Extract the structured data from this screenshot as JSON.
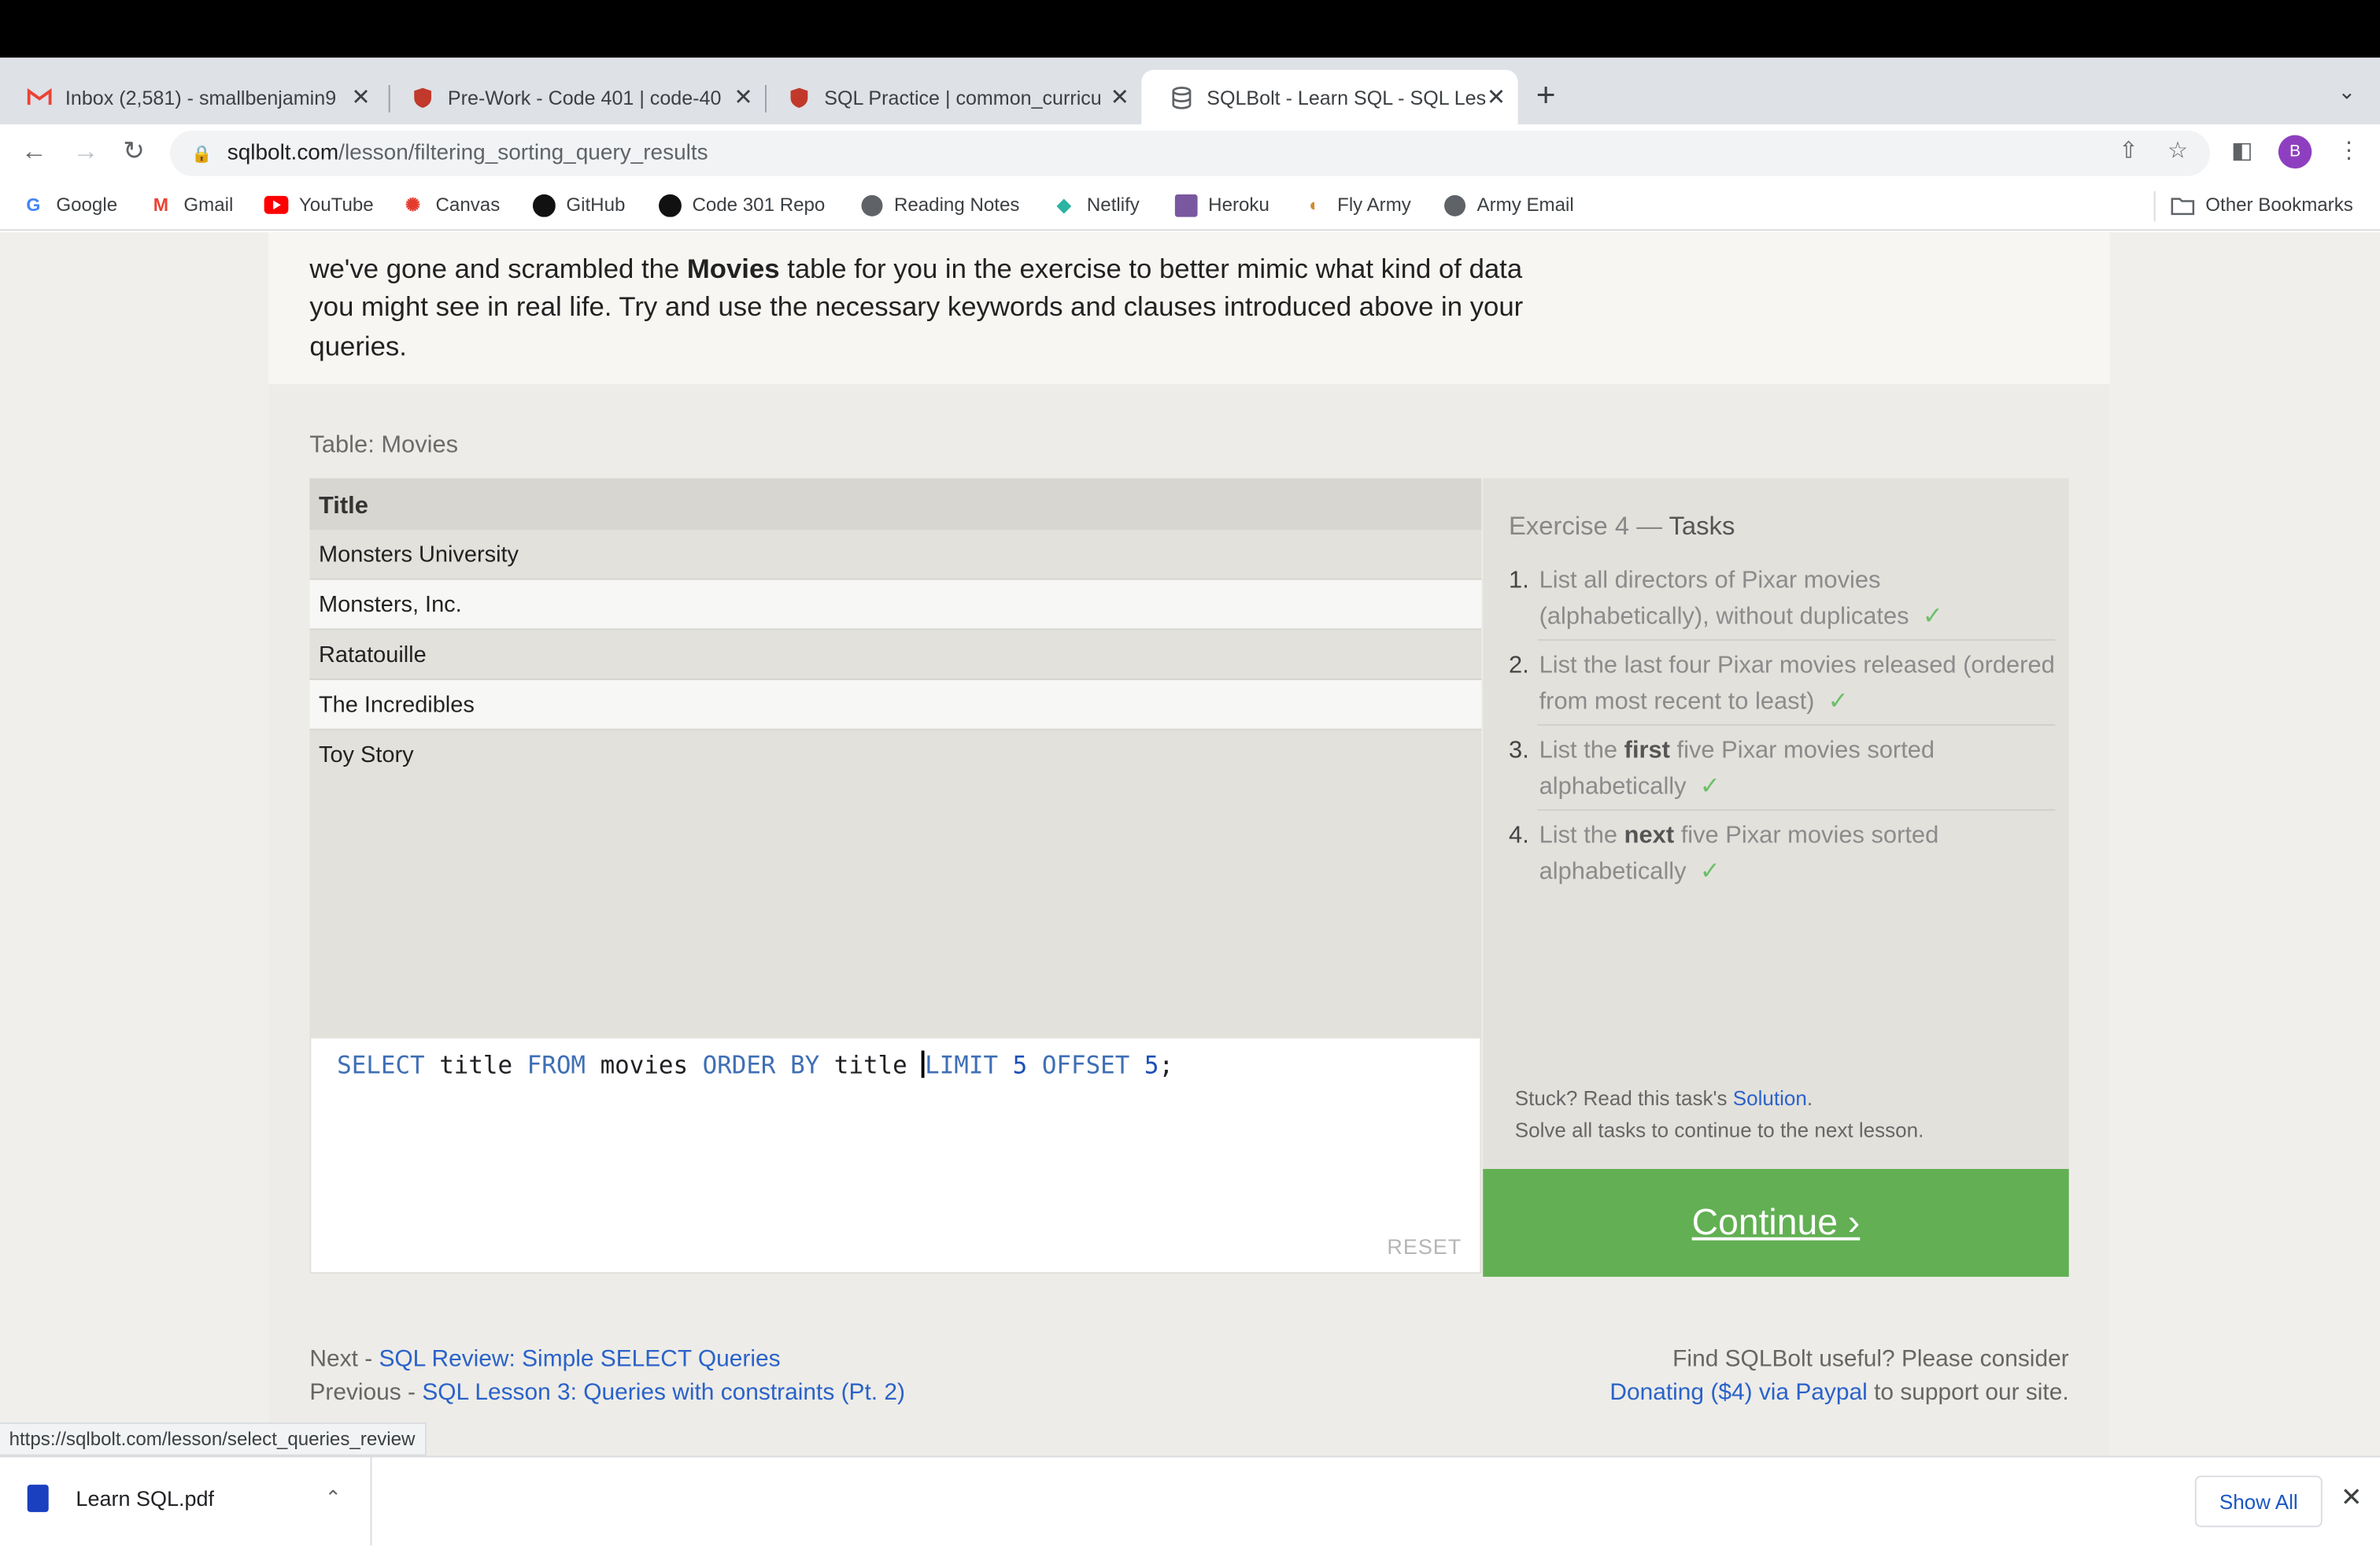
{
  "tabs": [
    {
      "label": "Inbox (2,581) - smallbenjamin9",
      "icon": "gmail-icon",
      "icon_color": "#ea4335"
    },
    {
      "label": "Pre-Work - Code 401 | code-40",
      "icon": "codefellows-icon",
      "icon_color": "#c0392b"
    },
    {
      "label": "SQL Practice | common_curricu",
      "icon": "codefellows-icon",
      "icon_color": "#c0392b"
    },
    {
      "label": "SQLBolt - Learn SQL - SQL Les",
      "icon": "database-icon",
      "icon_color": "#5f6368"
    }
  ],
  "address": {
    "host": "sqlbolt.com",
    "path": "/lesson/filtering_sorting_query_results"
  },
  "profile_initial": "B",
  "bookmarks": [
    {
      "label": "Google",
      "icon": "google-icon"
    },
    {
      "label": "Gmail",
      "icon": "gmail-icon"
    },
    {
      "label": "YouTube",
      "icon": "youtube-icon"
    },
    {
      "label": "Canvas",
      "icon": "canvas-icon"
    },
    {
      "label": "GitHub",
      "icon": "github-icon"
    },
    {
      "label": "Code 301 Repo",
      "icon": "github-icon"
    },
    {
      "label": "Reading Notes",
      "icon": "globe-icon"
    },
    {
      "label": "Netlify",
      "icon": "netlify-icon"
    },
    {
      "label": "Heroku",
      "icon": "heroku-icon"
    },
    {
      "label": "Fly Army",
      "icon": "army-icon"
    },
    {
      "label": "Army Email",
      "icon": "globe-icon"
    }
  ],
  "other_bookmarks": "Other Bookmarks",
  "lesson": {
    "line1_pre": "we've gone and scrambled the ",
    "line1_bold": "Movies",
    "line1_post": " table for you in the exercise to better mimic what kind of data",
    "line2": "you might see in real life. Try and use the necessary keywords and clauses introduced above in your",
    "line3": "queries."
  },
  "table": {
    "label": "Table: Movies",
    "header": "Title",
    "rows": [
      "Monsters University",
      "Monsters, Inc.",
      "Ratatouille",
      "The Incredibles",
      "Toy Story"
    ]
  },
  "editor": {
    "tokens": [
      "SELECT",
      " title ",
      "FROM",
      " movies ",
      "ORDER BY",
      " title ",
      "LIMIT",
      " ",
      "5",
      " ",
      "OFFSET",
      " ",
      "5",
      ";"
    ],
    "reset": "RESET"
  },
  "exercise": {
    "title_prefix": "Exercise 4 — ",
    "title_main": "Tasks",
    "tasks": [
      {
        "num": "1.",
        "pre": "List all directors of Pixar movies (alphabetically), without duplicates",
        "bold": "",
        "post": "",
        "check": "✓"
      },
      {
        "num": "2.",
        "pre": "List the last four Pixar movies released (ordered from most recent to least)",
        "bold": "",
        "post": "",
        "check": "✓"
      },
      {
        "num": "3.",
        "pre": "List the ",
        "bold": "first",
        "post": " five Pixar movies sorted alphabetically",
        "check": "✓"
      },
      {
        "num": "4.",
        "pre": "List the ",
        "bold": "next",
        "post": " five Pixar movies sorted alphabetically",
        "check": "✓"
      }
    ],
    "stuck_pre": "Stuck? Read this task's ",
    "stuck_link": "Solution",
    "stuck_post": ".",
    "solve_all": "Solve all tasks to continue to the next lesson.",
    "continue": "Continue ›"
  },
  "footer": {
    "next_label": "Next - ",
    "next_link": "SQL Review: Simple SELECT Queries",
    "prev_label": "Previous - ",
    "prev_link": "SQL Lesson 3: Queries with constraints (Pt. 2)",
    "useful": "Find SQLBolt useful? Please consider",
    "donate_link": "Donating ($4) via Paypal",
    "donate_post": " to support our site."
  },
  "status_url": "https://sqlbolt.com/lesson/select_queries_review",
  "downloads": {
    "file": "Learn SQL.pdf",
    "show_all": "Show All"
  },
  "colors": {
    "continue_green": "#62b053",
    "link_blue": "#2a62c9",
    "check_green": "#6abf69"
  }
}
